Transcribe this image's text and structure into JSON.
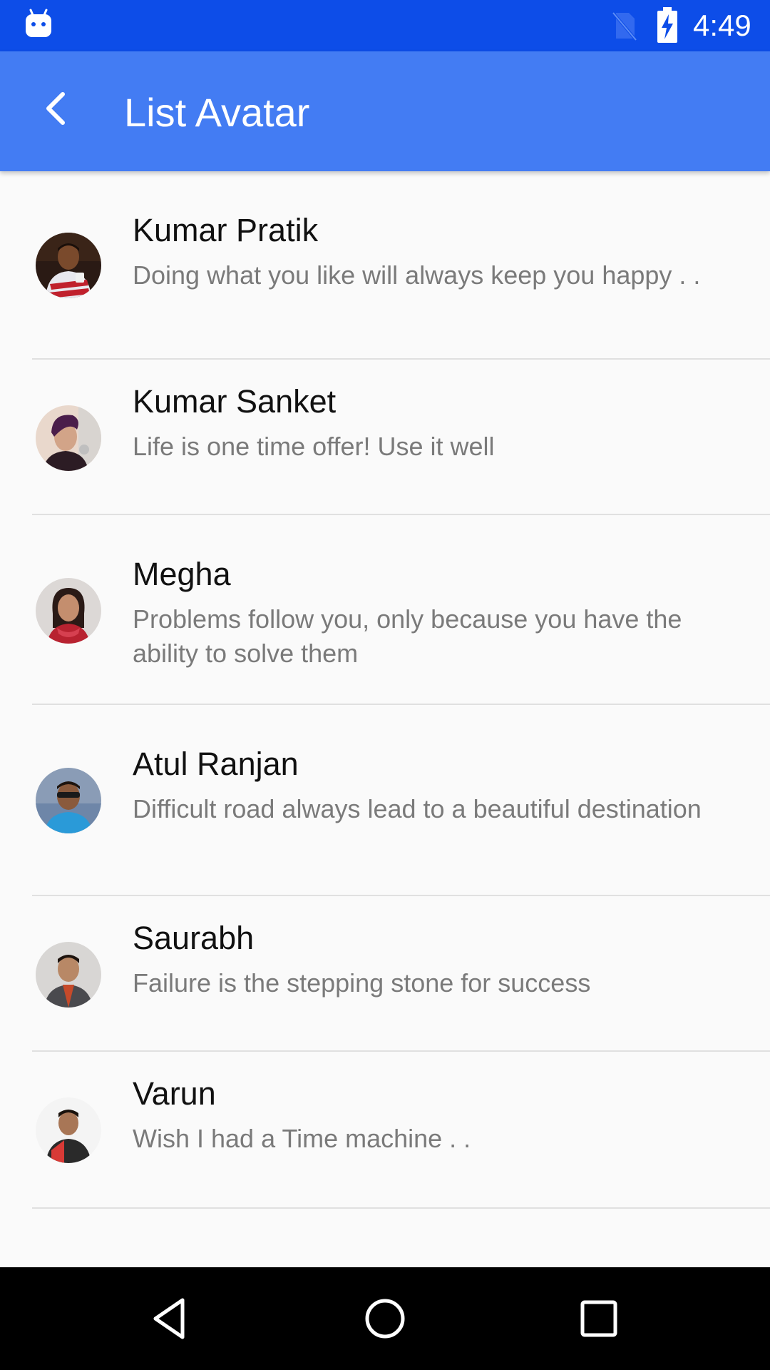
{
  "status_bar": {
    "time": "4:49",
    "left_icon": "android-robot-icon",
    "sim_icon": "no-sim-icon",
    "battery_icon": "battery-charging-icon"
  },
  "app_bar": {
    "title": "List Avatar",
    "back_icon": "arrow-back-icon"
  },
  "colors": {
    "status_bar": "#0d4de8",
    "app_bar": "#437cf3",
    "background": "#fafafa",
    "name_text": "#111111",
    "desc_text": "#7a7a7a",
    "divider": "#e0e0e0",
    "nav_bar": "#000000"
  },
  "list": {
    "items": [
      {
        "name": "Kumar Pratik",
        "description": "Doing what you like will always keep you happy . ."
      },
      {
        "name": "Kumar Sanket",
        "description": "Life is one time offer! Use it well"
      },
      {
        "name": "Megha",
        "description": "Problems follow you, only because you have the ability to solve them"
      },
      {
        "name": "Atul Ranjan",
        "description": "Difficult road always lead to a beautiful destination"
      },
      {
        "name": "Saurabh",
        "description": "Failure is the stepping stone for success"
      },
      {
        "name": "Varun",
        "description": "Wish I had a Time machine . ."
      }
    ]
  },
  "nav_bar": {
    "back_icon": "triangle-back-icon",
    "home_icon": "circle-home-icon",
    "recents_icon": "square-recents-icon"
  }
}
